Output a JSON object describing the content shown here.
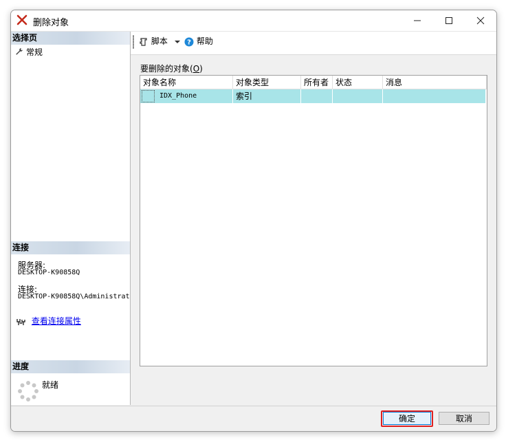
{
  "window": {
    "title": "删除对象"
  },
  "left": {
    "select_page_header": "选择页",
    "nav_items": [
      {
        "label": "常规",
        "icon": "wrench-icon"
      }
    ],
    "connection_header": "连接",
    "server_label": "服务器:",
    "server_value": "DESKTOP-K90858Q",
    "connection_label": "连接:",
    "connection_value": "DESKTOP-K90858Q\\Administrat",
    "view_connection_link": "查看连接属性",
    "progress_header": "进度",
    "progress_status": "就绪"
  },
  "toolbar": {
    "script_label": "脚本",
    "help_label": "帮助"
  },
  "main": {
    "objects_label_prefix": "要删除的对象(",
    "objects_label_accel": "O",
    "objects_label_suffix": ")",
    "columns": [
      "对象名称",
      "对象类型",
      "所有者",
      "状态",
      "消息"
    ],
    "rows": [
      {
        "name": "IDX_Phone",
        "type": "索引",
        "owner": "",
        "status": "",
        "message": ""
      }
    ]
  },
  "buttons": {
    "ok": "确定",
    "cancel": "取消"
  },
  "colors": {
    "selected_row": "#a8e4e8",
    "section_header": "#c9d6e4",
    "link": "#0000ee",
    "highlight": "#e02020"
  }
}
